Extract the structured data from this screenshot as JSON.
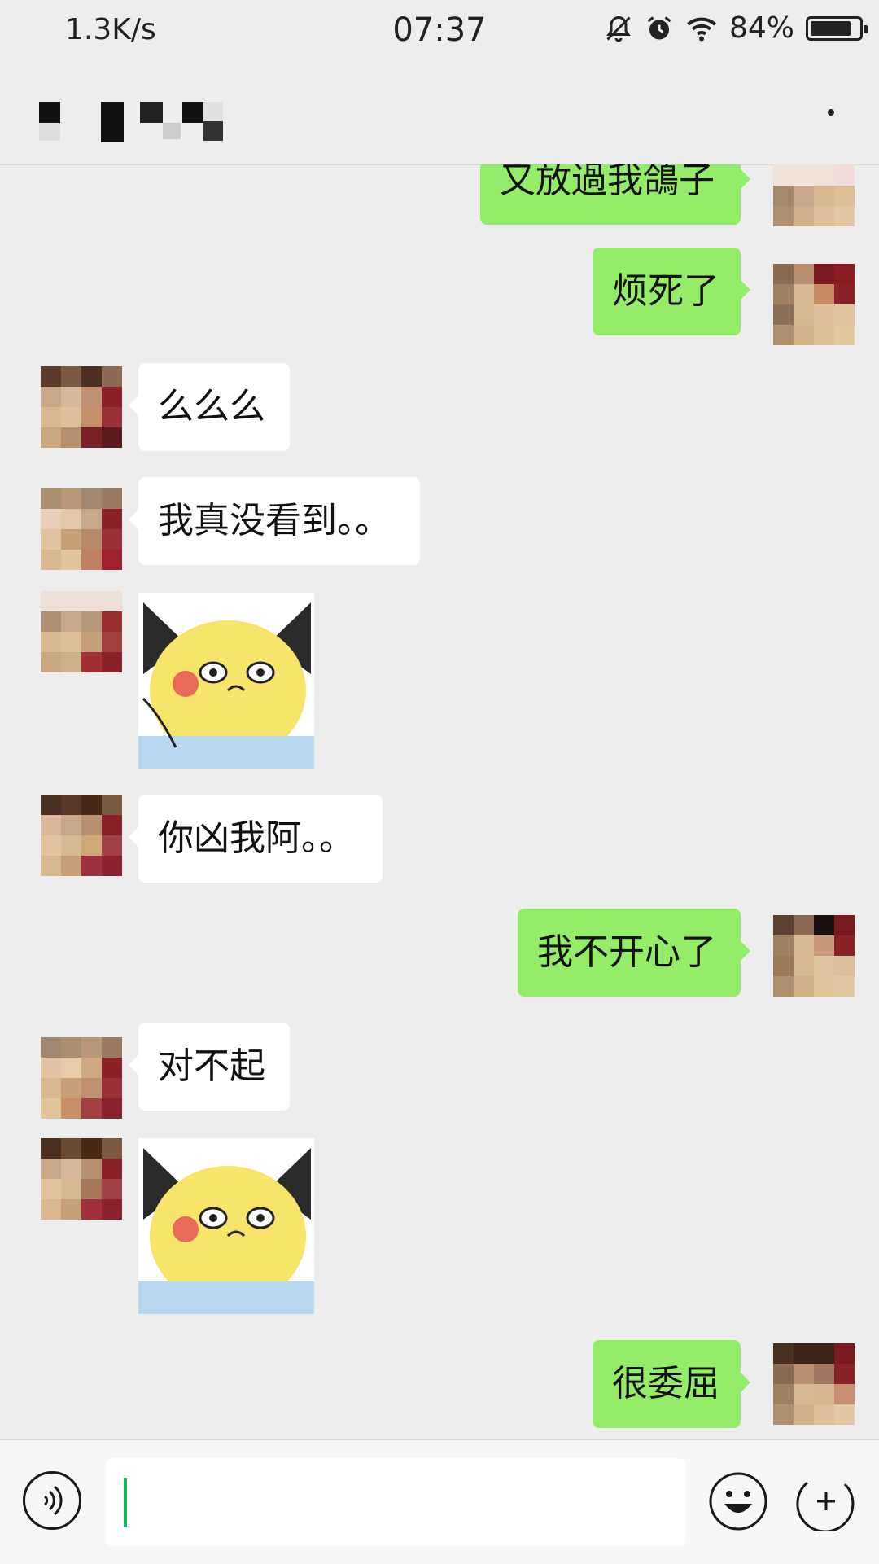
{
  "status_bar": {
    "network_speed": "1.3K/s",
    "time": "07:37",
    "battery": "84%",
    "battery_level": 0.84,
    "icons": [
      "notifications-off-icon",
      "alarm-icon",
      "wifi-icon",
      "battery-icon"
    ]
  },
  "header": {
    "title_note": "",
    "more_icon": "more-icon"
  },
  "colors": {
    "background": "#EDEDED",
    "bubble_self": "#95EC69",
    "bubble_other": "#FFFFFF",
    "accent": "#07C160"
  },
  "messages": [
    {
      "side": "right",
      "type": "text",
      "text": "又放過我鴿子"
    },
    {
      "side": "right",
      "type": "text",
      "text": "烦死了"
    },
    {
      "side": "left",
      "type": "text",
      "text": "么么么"
    },
    {
      "side": "left",
      "type": "text",
      "text": "我真没看到。。"
    },
    {
      "side": "left",
      "type": "sticker",
      "text": ""
    },
    {
      "side": "left",
      "type": "text",
      "text": "你凶我阿。。"
    },
    {
      "side": "right",
      "type": "text",
      "text": "我不开心了"
    },
    {
      "side": "left",
      "type": "text",
      "text": "对不起"
    },
    {
      "side": "left",
      "type": "sticker",
      "text": ""
    },
    {
      "side": "right",
      "type": "text",
      "text": "很委屈"
    }
  ],
  "input_bar": {
    "voice_icon": "voice-icon",
    "input_value": "",
    "emoji_icon": "emoji-icon",
    "more_icon": "plus-icon"
  }
}
